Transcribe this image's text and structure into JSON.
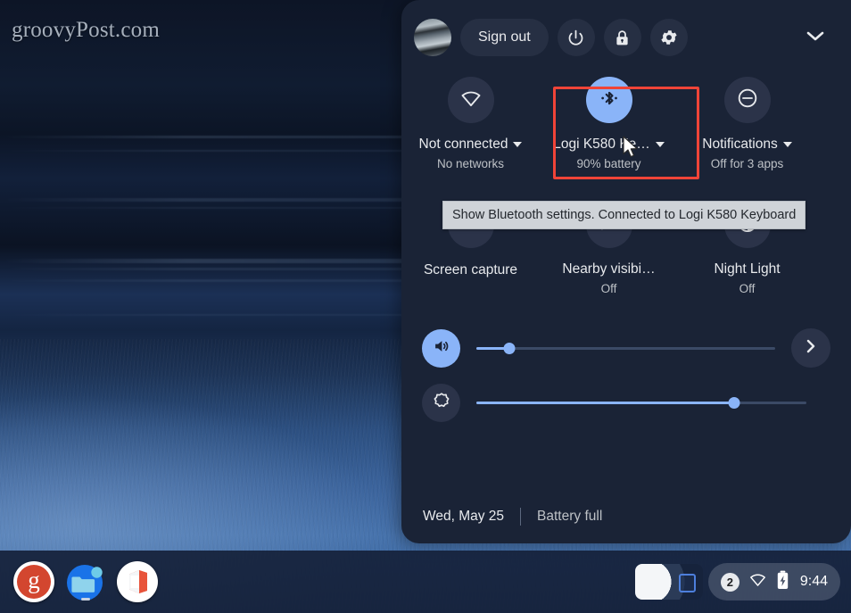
{
  "watermark": "groovyPost.com",
  "quick_settings": {
    "header": {
      "avatar_name": "user-avatar",
      "sign_out_label": "Sign out",
      "power_icon": "power-icon",
      "lock_icon": "lock-icon",
      "settings_icon": "gear-icon",
      "collapse_icon": "chevron-down-icon"
    },
    "tiles": [
      {
        "id": "network",
        "icon": "wifi-off-icon",
        "label": "Not connected",
        "sublabel": "No networks",
        "has_caret": true,
        "active": false,
        "highlighted": false
      },
      {
        "id": "bluetooth",
        "icon": "bluetooth-connected-icon",
        "label": "Logi K580 Ke…",
        "sublabel": "90% battery",
        "has_caret": true,
        "active": true,
        "highlighted": true
      },
      {
        "id": "notifications",
        "icon": "do-not-disturb-icon",
        "label": "Notifications",
        "sublabel": "Off for 3 apps",
        "has_caret": true,
        "active": false,
        "highlighted": false
      },
      {
        "id": "screen-capture",
        "icon": "screen-capture-icon",
        "label": "Screen capture",
        "sublabel": "",
        "has_caret": false,
        "active": false,
        "highlighted": false
      },
      {
        "id": "nearby-visibility",
        "icon": "eye-off-icon",
        "label": "Nearby visibi…",
        "sublabel": "Off",
        "has_caret": false,
        "active": false,
        "highlighted": false
      },
      {
        "id": "night-light",
        "icon": "night-light-moon-icon",
        "label": "Night Light",
        "sublabel": "Off",
        "has_caret": false,
        "active": false,
        "highlighted": false
      }
    ],
    "tooltip": {
      "text": "Show Bluetooth settings. Connected to Logi K580 Keyboard"
    },
    "sliders": [
      {
        "id": "volume",
        "icon": "volume-on-icon",
        "value_percent": 11,
        "icon_active": true,
        "has_next": true,
        "next_icon": "chevron-right-icon"
      },
      {
        "id": "brightness",
        "icon": "brightness-icon",
        "value_percent": 78,
        "icon_active": false,
        "has_next": false,
        "next_icon": ""
      }
    ],
    "footer": {
      "date": "Wed, May 25",
      "battery_status": "Battery full"
    },
    "colors": {
      "panel_bg": "#1a2336",
      "accent": "#8ab4f8",
      "tile_bg": "#2b3349",
      "highlight_outline": "#f04438",
      "tooltip_bg": "#cfd3d8"
    }
  },
  "shelf": {
    "apps": [
      {
        "id": "launcher",
        "icon": "google-launcher-icon",
        "glyph": "g",
        "running": false
      },
      {
        "id": "files",
        "icon": "files-folder-icon",
        "glyph": "",
        "running": true
      },
      {
        "id": "office",
        "icon": "microsoft-office-icon",
        "glyph": "",
        "running": false
      }
    ],
    "tray": {
      "preview_name": "screen-preview-thumbnail",
      "notification_count": "2",
      "wifi_icon": "wifi-icon",
      "battery_icon": "battery-charging-icon",
      "clock": "9:44"
    }
  }
}
